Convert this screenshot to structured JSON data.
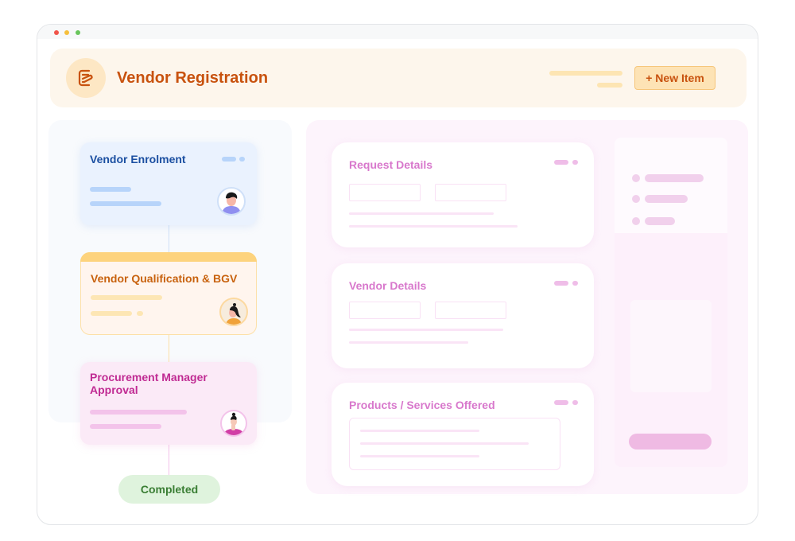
{
  "window": {
    "controls": [
      "close",
      "minimize",
      "maximize"
    ]
  },
  "header": {
    "icon": "document-edit-icon",
    "title": "Vendor Registration",
    "new_item_label": "+ New Item",
    "colors": {
      "accent": "#c8520e",
      "background": "#fdf6ec",
      "button_bg": "#fde3b5"
    }
  },
  "workflow": {
    "stages": [
      {
        "title": "Vendor Enrolment",
        "color": "#1b4fa1",
        "avatar": "male-user-avatar"
      },
      {
        "title": "Vendor Qualification & BGV",
        "color": "#c8620e",
        "avatar": "female-user-avatar"
      },
      {
        "title": "Procurement Manager Approval",
        "color": "#c02b93",
        "avatar": "female-manager-avatar"
      }
    ],
    "final_status": {
      "label": "Completed",
      "color": "#3a7e34"
    }
  },
  "form": {
    "sections": [
      {
        "title": "Request Details"
      },
      {
        "title": "Vendor Details"
      },
      {
        "title": "Products / Services Offered"
      }
    ],
    "accent": "#d878cc"
  }
}
